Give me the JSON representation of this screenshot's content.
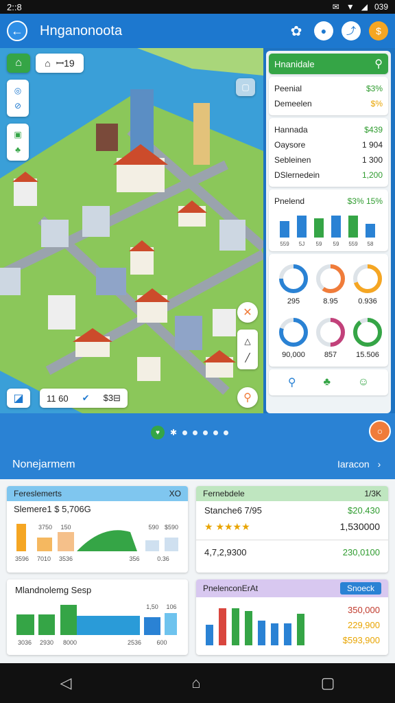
{
  "status_bar": {
    "time": "2::8",
    "battery": "039"
  },
  "app_bar": {
    "title": "Hnganonoota"
  },
  "map": {
    "top_chip_text": "ꟷ19",
    "bottom_chip_value": "11 60",
    "bottom_chip_price": "$3⊟"
  },
  "side": {
    "header": "Hnanidale",
    "card1": [
      {
        "label": "Peenial",
        "value": "$3%"
      },
      {
        "label": "Demeelen",
        "value": "$%"
      }
    ],
    "card2_title": "Hannada",
    "card2_title_value": "$439",
    "card2": [
      {
        "label": "Oaysore",
        "value": "1 904"
      },
      {
        "label": "Sebleinen",
        "value": "1 300"
      },
      {
        "label": "DSlernedein",
        "value": "1,200"
      }
    ],
    "bar_card_title": "Pnelend",
    "bar_card_values": "$3% 15%",
    "bar_labels": [
      "559",
      "5J",
      "59",
      "59",
      "559",
      "58"
    ],
    "bar_values": [
      0.6,
      0.8,
      0.7,
      0.8,
      0.8,
      0.5
    ],
    "rings": [
      {
        "value": "295",
        "color": "#2a82d4",
        "fraction": 0.75
      },
      {
        "value": "8.95",
        "color": "#f07c3a",
        "fraction": 0.6
      },
      {
        "value": "0.936",
        "color": "#f5a623",
        "fraction": 0.7
      },
      {
        "value": "90,000",
        "color": "#2a82d4",
        "fraction": 0.8
      },
      {
        "value": "857",
        "color": "#c2417a",
        "fraction": 0.5
      },
      {
        "value": "15.506",
        "color": "#35a546",
        "fraction": 0.9
      }
    ]
  },
  "band": {
    "section_title": "Nonejarmem",
    "section_link": "Iaracon"
  },
  "cards": {
    "c1": {
      "head": "Fereslemerts",
      "head_right": "XO",
      "title": "Slemere1 $ 5,706G",
      "labels": [
        "3596",
        "7010",
        "3536",
        "356",
        "0.36"
      ],
      "nums": [
        "3750",
        "150",
        "590",
        "$590"
      ]
    },
    "c2": {
      "head": "Fernebdele",
      "head_right": "1/3K",
      "title": "Stanche6 7/95",
      "right1": "$20.430",
      "right2": "1,530000",
      "bottom_left": "4,7,2,9300",
      "bottom_right": "230,0100"
    },
    "c3": {
      "title": "Mlandnolemg Sesp",
      "labels": [
        "3036",
        "2930",
        "8000",
        "2536",
        "600"
      ],
      "nums": [
        "1,50",
        "106"
      ]
    },
    "c4": {
      "head": "PnelenconErAt",
      "button": "Snoeck",
      "vals": [
        "350,000",
        "229,900",
        "$593,900"
      ]
    }
  }
}
